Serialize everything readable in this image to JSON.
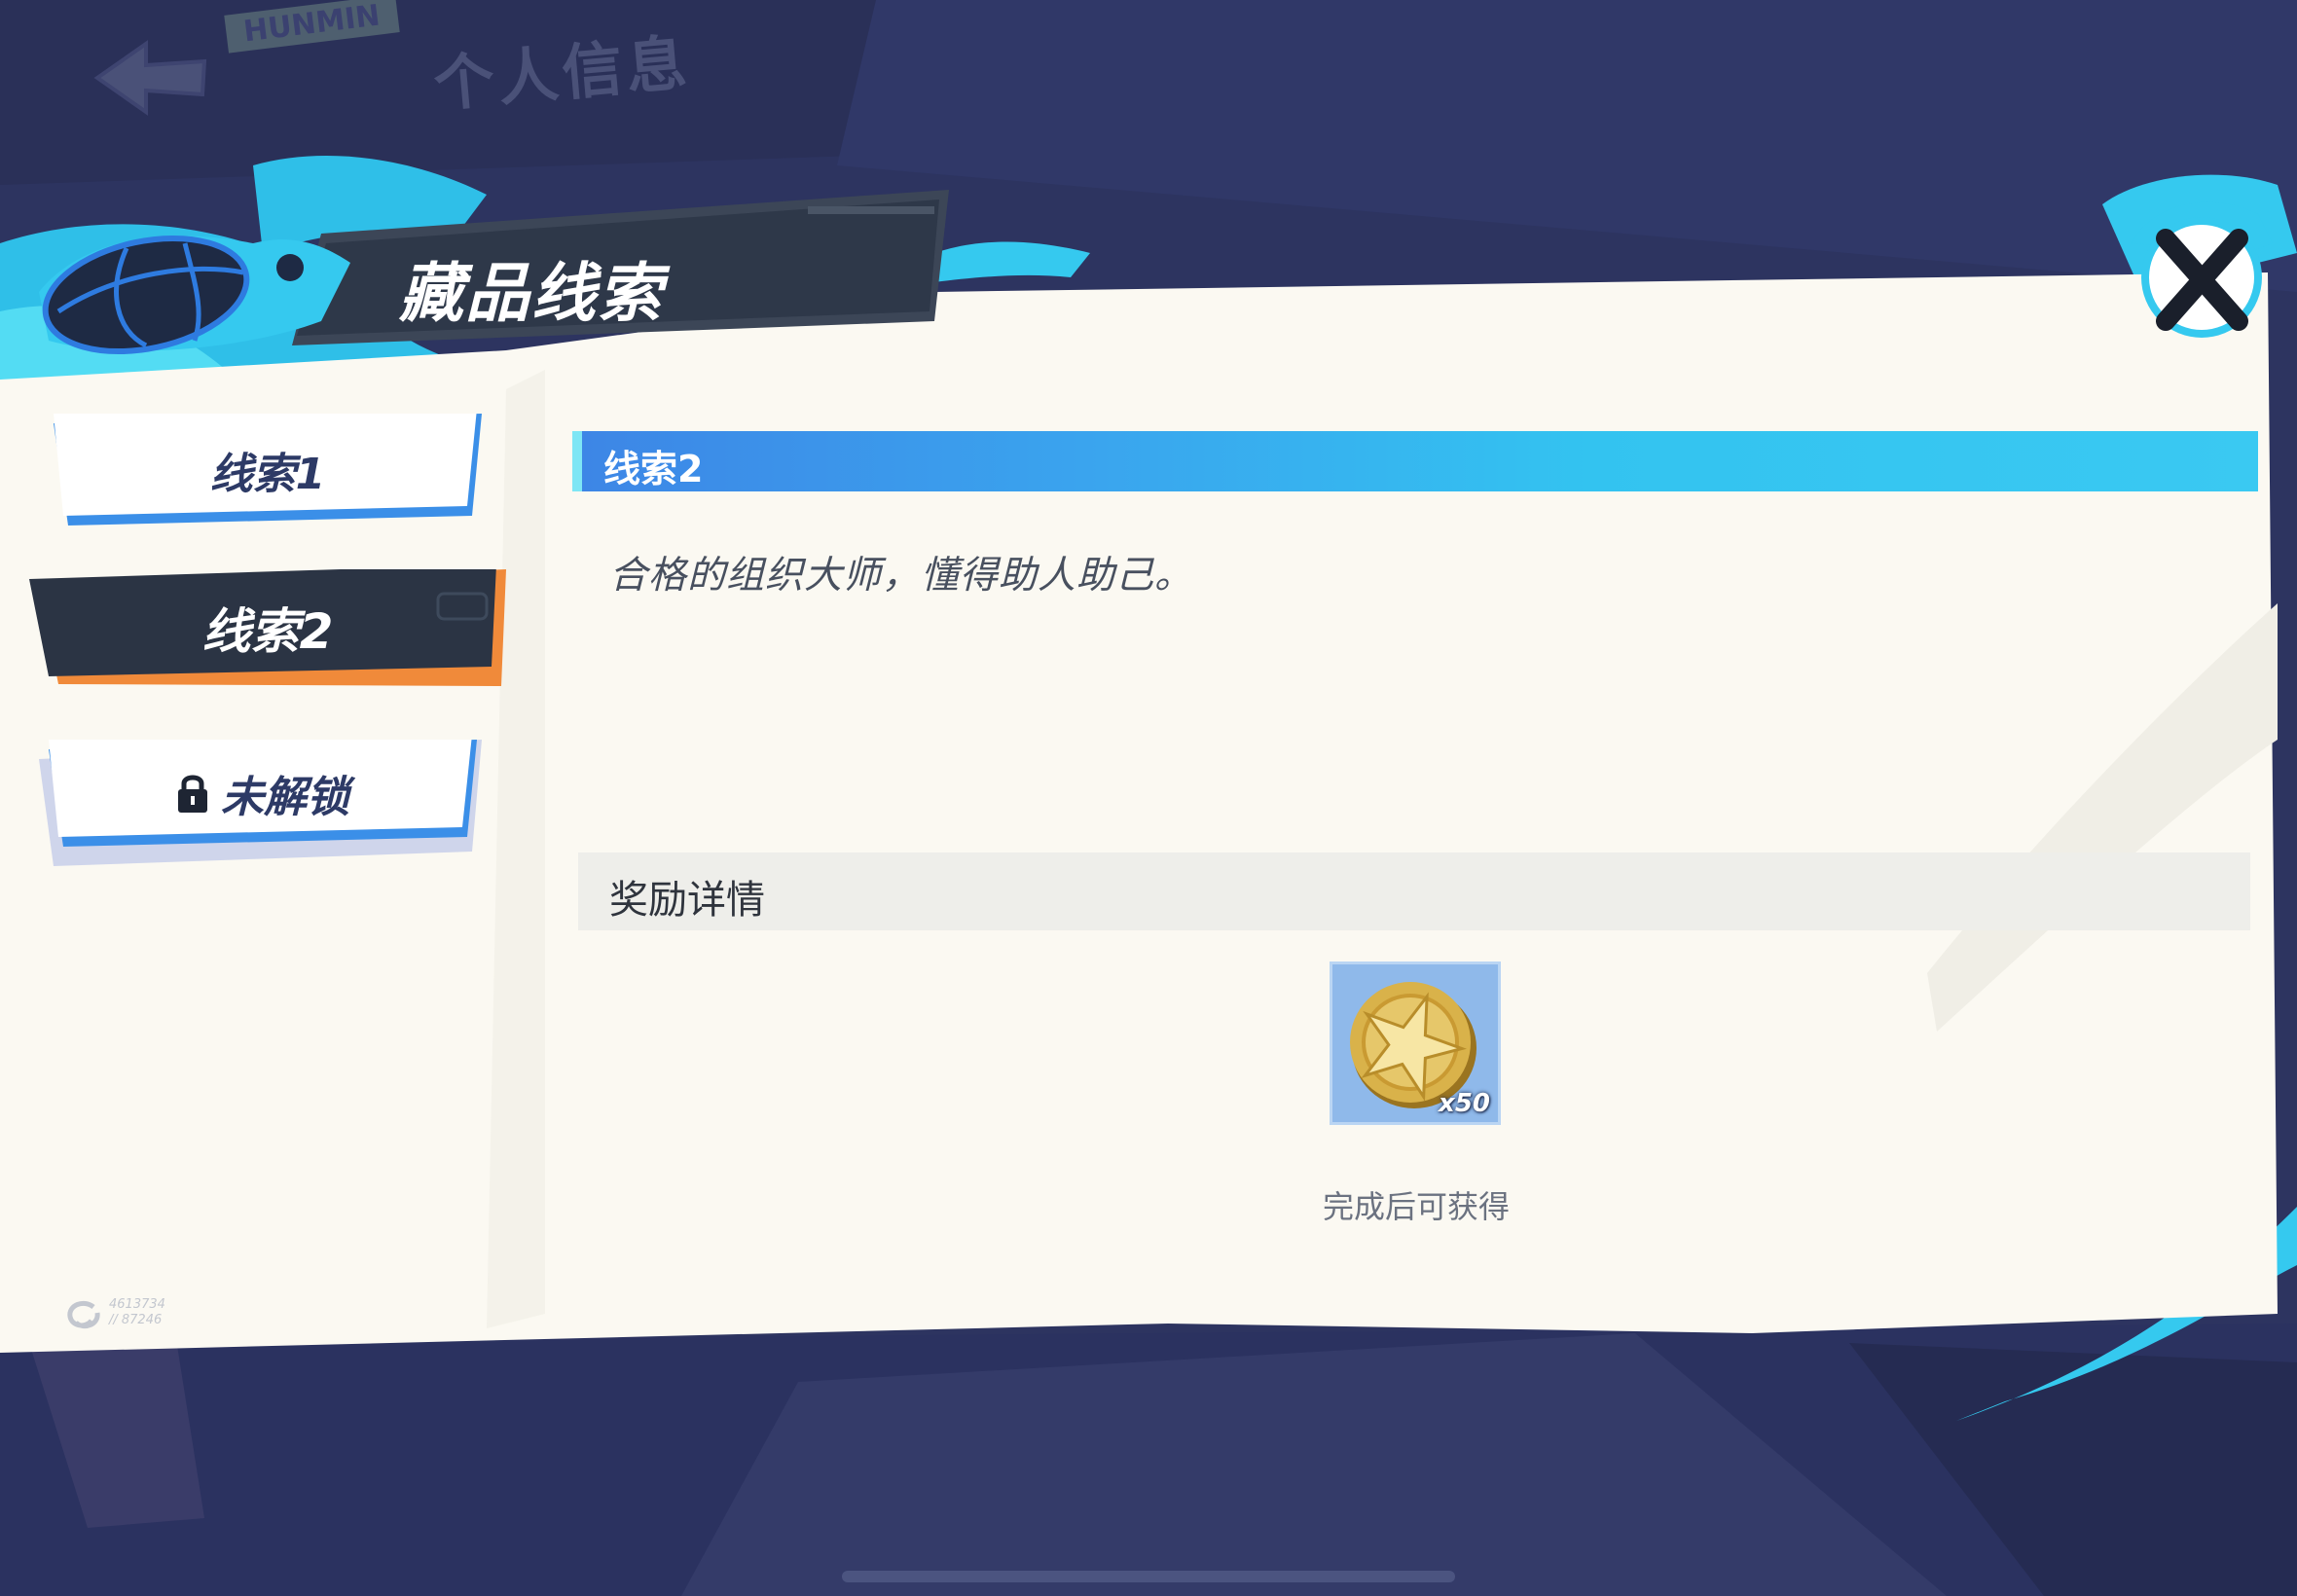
{
  "background": {
    "title": "个人信息",
    "tag": "HUNMIN"
  },
  "header": {
    "title": "藏品线索"
  },
  "tabs": [
    {
      "label": "线索1",
      "state": "normal"
    },
    {
      "label": "线索2",
      "state": "selected"
    },
    {
      "label": "未解锁",
      "state": "locked"
    }
  ],
  "clue": {
    "title": "线索2",
    "description": "合格的组织大师，懂得助人助己。"
  },
  "reward": {
    "section_title": "奖励详情",
    "item_icon": "gold-star-coin-icon",
    "quantity": "x50",
    "hint": "完成后可获得"
  },
  "footer": {
    "version_line1": "4613734",
    "version_line2": "// 87246"
  },
  "colors": {
    "accent_blue": "#3aa4ee",
    "cyan": "#33c3f0",
    "panel": "#fbf9f2",
    "background": "#2d3460",
    "selected_tab": "#2b3444",
    "orange_accent": "#f08a3a"
  }
}
